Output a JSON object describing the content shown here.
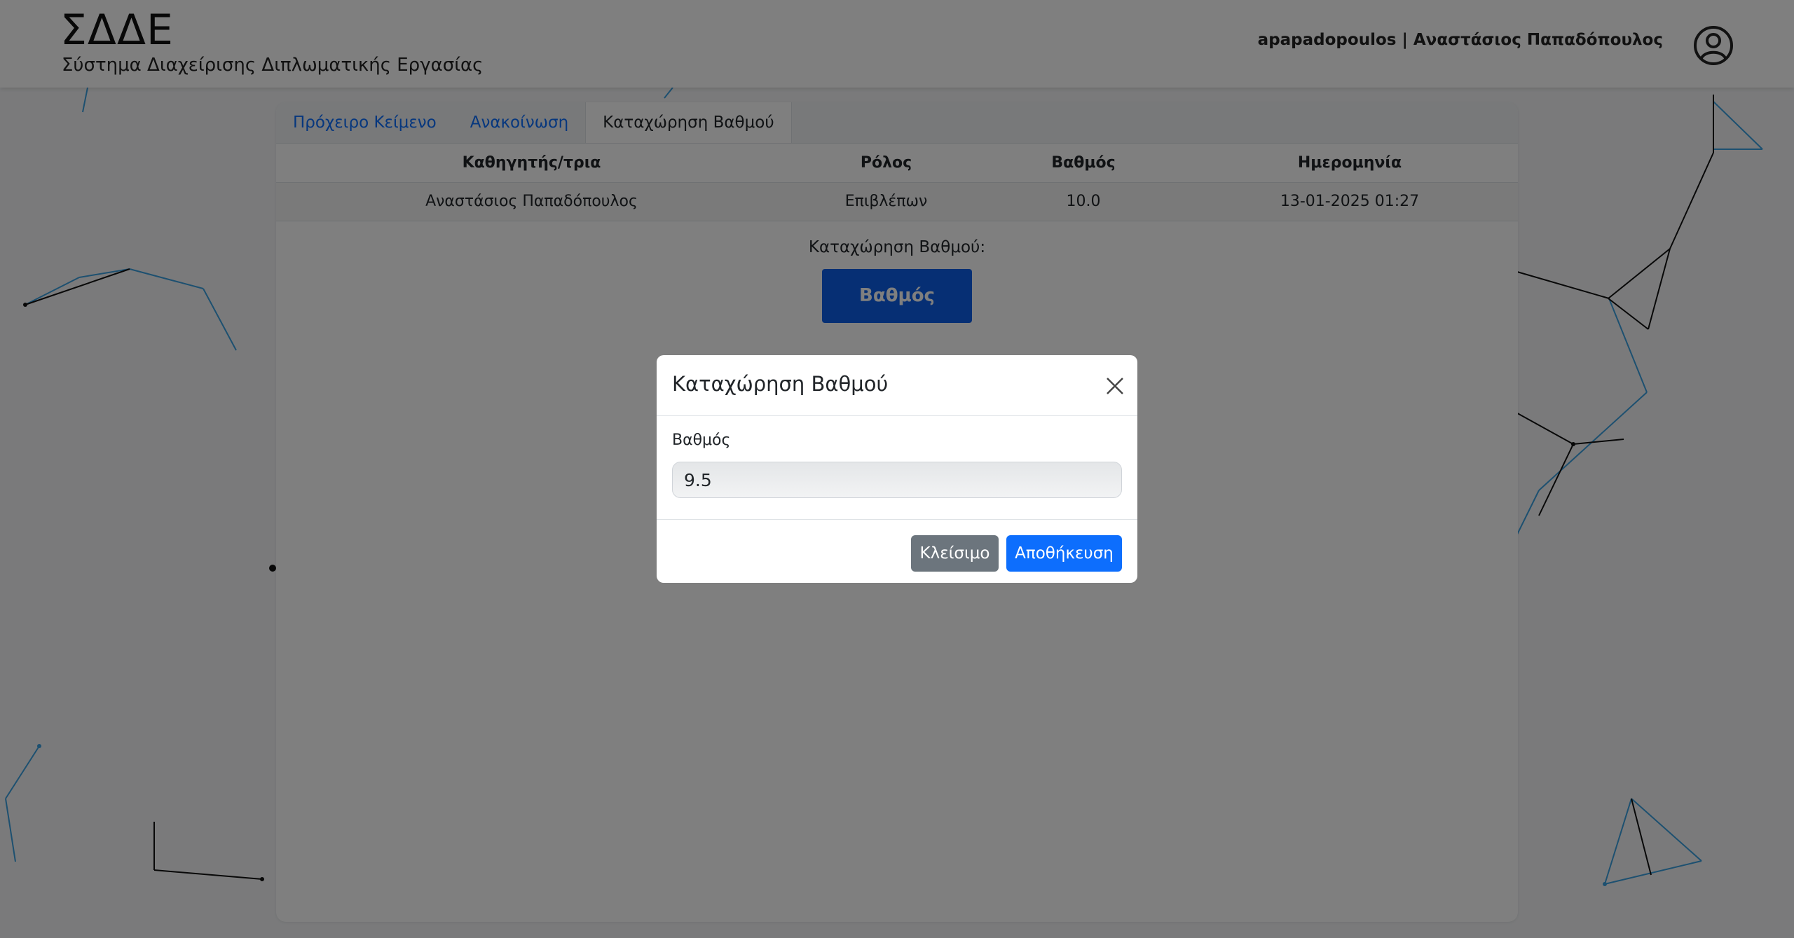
{
  "header": {
    "title": "ΣΔΔΕ",
    "subtitle": "Σύστημα Διαχείρισης Διπλωματικής Εργασίας",
    "user": "apapadopoulos | Αναστάσιος Παπαδόπουλος",
    "avatar_icon": "user-circle-icon"
  },
  "tabs": [
    {
      "label": "Πρόχειρο Κείμενο",
      "active": false
    },
    {
      "label": "Ανακοίνωση",
      "active": false
    },
    {
      "label": "Καταχώρηση Βαθμού",
      "active": true
    }
  ],
  "grades_table": {
    "columns": [
      "Καθηγητής/τρια",
      "Ρόλος",
      "Βαθμός",
      "Ημερομηνία"
    ],
    "rows": [
      {
        "professor": "Αναστάσιος Παπαδόπουλος",
        "role": "Επιβλέπων",
        "grade": "10.0",
        "date": "13-01-2025 01:27"
      }
    ]
  },
  "grade_entry": {
    "label": "Καταχώρηση Βαθμού:",
    "button_label": "Βαθμός"
  },
  "modal": {
    "title": "Καταχώρηση Βαθμού",
    "close_icon": "close-icon",
    "field_label": "Βαθμός",
    "field_value": "9.5",
    "close_button": "Κλείσιμο",
    "save_button": "Αποθήκευση"
  },
  "colors": {
    "primary": "#0d6efd",
    "primary_dark": "#0d5fe8",
    "secondary": "#6c757d",
    "network_blue": "#3aa0e0",
    "network_dark": "#111111"
  }
}
